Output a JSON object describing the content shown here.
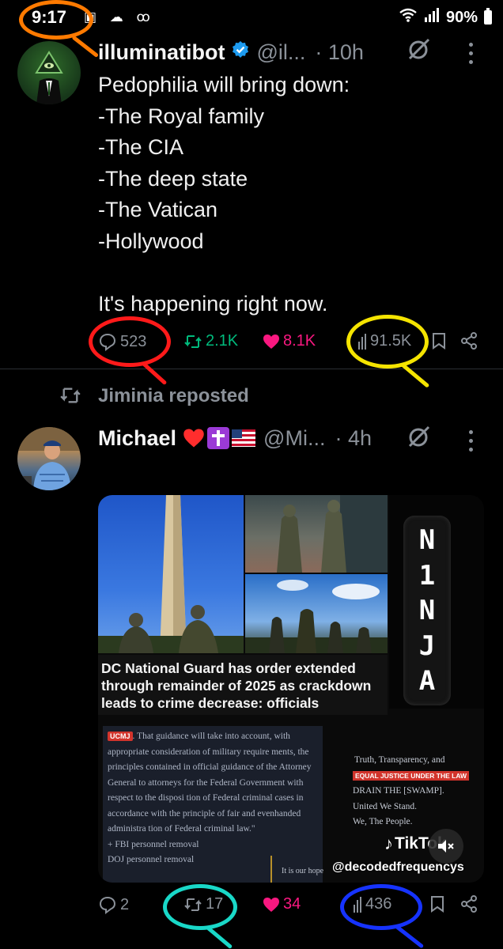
{
  "status_bar": {
    "time": "9:17",
    "battery": "90%",
    "icons": [
      "notification-icon",
      "cloud-icon",
      "voicemail-icon",
      "wifi-icon",
      "signal-icon",
      "battery-icon"
    ]
  },
  "tweet1": {
    "name": "illuminatibot",
    "verified": true,
    "handle": "@il...",
    "time": "· 10h",
    "body": "Pedophilia will bring down:\n-The Royal family\n-The CIA\n-The deep state\n-The Vatican\n-Hollywood\n\nIt's happening right now.",
    "replies": "523",
    "reposts": "2.1K",
    "likes": "8.1K",
    "views": "91.5K"
  },
  "repost_banner": {
    "text": "Jiminia reposted"
  },
  "tweet2": {
    "name": "Michael",
    "emojis": "❤️✝️🇺🇸",
    "handle": "@Mi...",
    "time": "· 4h",
    "media": {
      "vertical_text": [
        "N",
        "1",
        "N",
        "J",
        "A"
      ],
      "headline": "DC National Guard has order extended through remainder of 2025 as crackdown leads to crime decrease: officials",
      "doc_tag": "UCMJ",
      "doc_text": ". That guidance will take into account, with appropriate consideration of military require ments, the principles contained in official guidance of the Attorney General to attorneys for the Federal Government with respect to the disposi tion of Federal criminal cases in accordance with the principle of fair and evenhanded administra tion of Federal criminal law.\"",
      "doc_bullets": [
        "+ FBI personnel removal",
        "DOJ personnel removal"
      ],
      "side_line1": "Truth, Transparency, and",
      "side_badge": "EQUAL JUSTICE UNDER THE LAW",
      "side_line3": "DRAIN THE [SWAMP].",
      "side_line4": "United We Stand.",
      "side_line5": "We, The People.",
      "bottom_fragment": "It is our hope",
      "tiktok_label": "TikTok",
      "tiktok_handle": "@decodedfrequencys"
    },
    "replies": "2",
    "reposts": "17",
    "likes": "34",
    "views": "436"
  },
  "colors": {
    "background": "#000000",
    "text": "#e7e9ea",
    "muted": "#8b9199",
    "repost_green": "#00ba7c",
    "like_pink": "#f91880",
    "verified_blue": "#1d9bf0",
    "circle_orange": "#ff7a00",
    "circle_red": "#ff1a1a",
    "circle_yellow": "#f5e400",
    "circle_teal": "#19d8c8",
    "circle_blue": "#1633ff"
  }
}
